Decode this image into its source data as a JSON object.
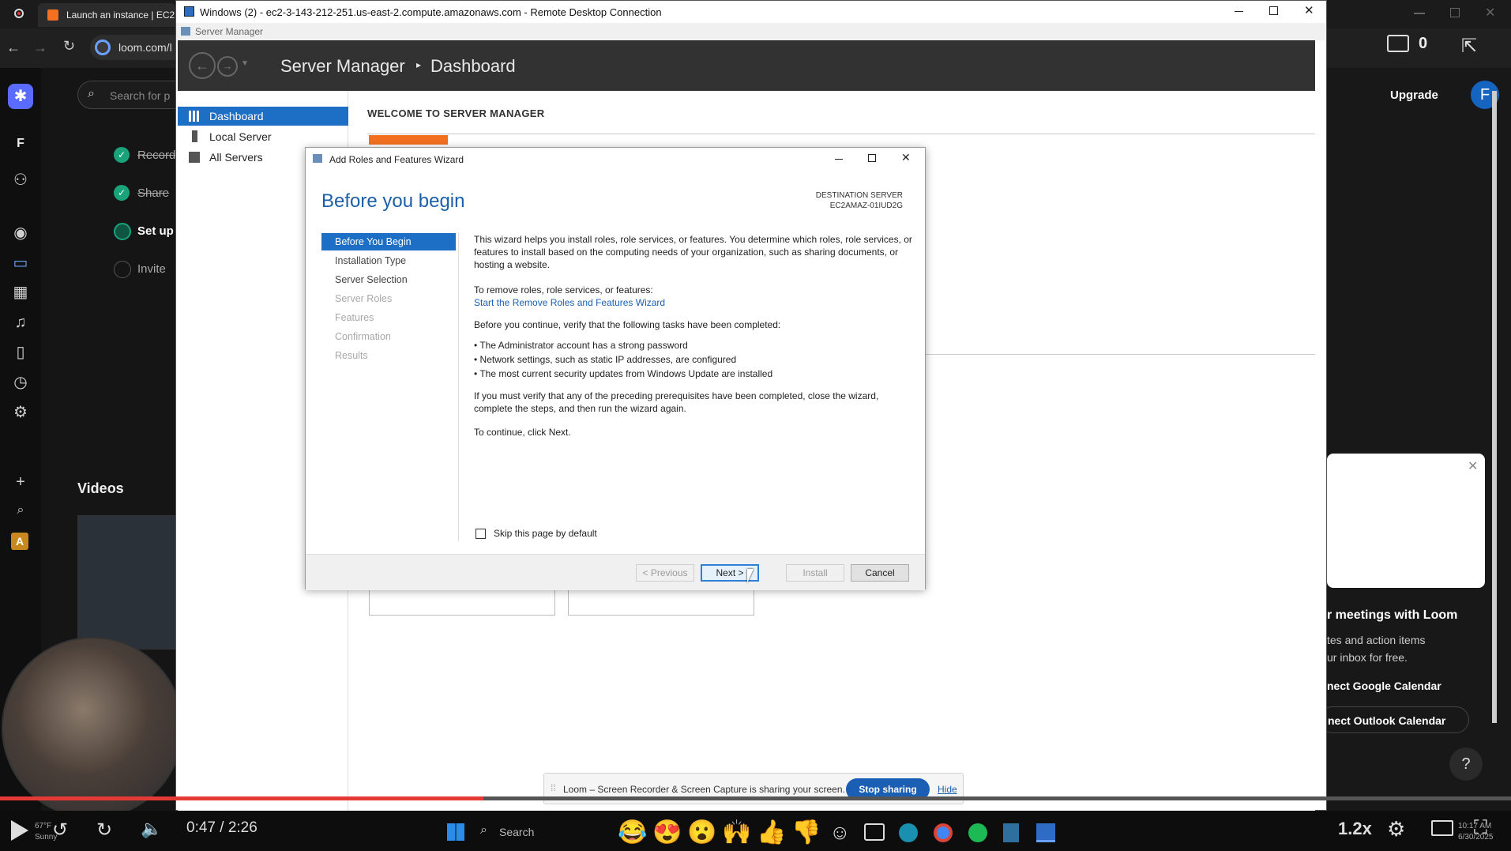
{
  "browser": {
    "tab_title": "Launch an instance | EC2 |",
    "address": "loom.com/l",
    "search_placeholder": "Search for p"
  },
  "loom": {
    "checklist": [
      "Record",
      "Share",
      "Set up",
      "Invite"
    ],
    "videos_heading": "Videos",
    "upgrade_label": "Upgrade",
    "avatar_letter": "F",
    "workspace_letter": "F",
    "workspace_letter2": "A",
    "comment_count": "0",
    "promo": {
      "title": "r meetings with Loom",
      "line1": "tes and action items",
      "line2": "ur inbox for free.",
      "google": "nect Google Calendar",
      "outlook": "nect Outlook Calendar"
    },
    "help": "?"
  },
  "rdp": {
    "title": "Windows (2) - ec2-3-143-212-251.us-east-2.compute.amazonaws.com - Remote Desktop Connection",
    "server_manager_strip": "Server Manager",
    "breadcrumb_app": "Server Manager",
    "breadcrumb_page": "Dashboard",
    "nav": [
      "Dashboard",
      "Local Server",
      "All Servers"
    ],
    "welcome_heading": "WELCOME TO SERVER MANAGER"
  },
  "wizard": {
    "title": "Add Roles and Features Wizard",
    "heading": "Before you begin",
    "dest_label": "DESTINATION SERVER",
    "dest_name": "EC2AMAZ-01IUD2G",
    "steps": [
      {
        "label": "Before You Begin",
        "state": "active"
      },
      {
        "label": "Installation Type",
        "state": "enabled"
      },
      {
        "label": "Server Selection",
        "state": "enabled"
      },
      {
        "label": "Server Roles",
        "state": "disabled"
      },
      {
        "label": "Features",
        "state": "disabled"
      },
      {
        "label": "Confirmation",
        "state": "disabled"
      },
      {
        "label": "Results",
        "state": "disabled"
      }
    ],
    "intro_1": "This wizard helps you install roles, role services, or features. You determine which roles, role services, or",
    "intro_2": "features to install based on the computing needs of your organization, such as sharing documents, or",
    "intro_3": "hosting a website.",
    "remove_label": "To remove roles, role services, or features:",
    "remove_link": "Start the Remove Roles and Features Wizard",
    "verify_label": "Before you continue, verify that the following tasks have been completed:",
    "bullets": [
      "The Administrator account has a strong password",
      "Network settings, such as static IP addresses, are configured",
      "The most current security updates from Windows Update are installed"
    ],
    "prereq_1": "If you must verify that any of the preceding prerequisites have been completed, close the wizard,",
    "prereq_2": "complete the steps, and then run the wizard again.",
    "continue_text": "To continue, click Next.",
    "skip_label": "Skip this page by default",
    "buttons": {
      "previous": "< Previous",
      "next": "Next >",
      "install": "Install",
      "cancel": "Cancel"
    }
  },
  "share_banner": {
    "text": "Loom – Screen Recorder & Screen Capture is sharing your screen.",
    "stop": "Stop sharing",
    "hide": "Hide"
  },
  "player": {
    "time": "0:47 / 2:26",
    "speed": "1.2x",
    "progress": 0.32,
    "weather_temp": "67°F",
    "weather_desc": "Sunny",
    "taskbar_search": "Search",
    "clock_time": "10:17 AM",
    "clock_date": "6/30/2025"
  },
  "colors": {
    "accent": "#1c6fc5",
    "link": "#1a5fb4",
    "sm_header": "#323232",
    "loom_blue": "#1565c0",
    "progress_red": "#e53935",
    "orange_tile": "#f37021"
  }
}
